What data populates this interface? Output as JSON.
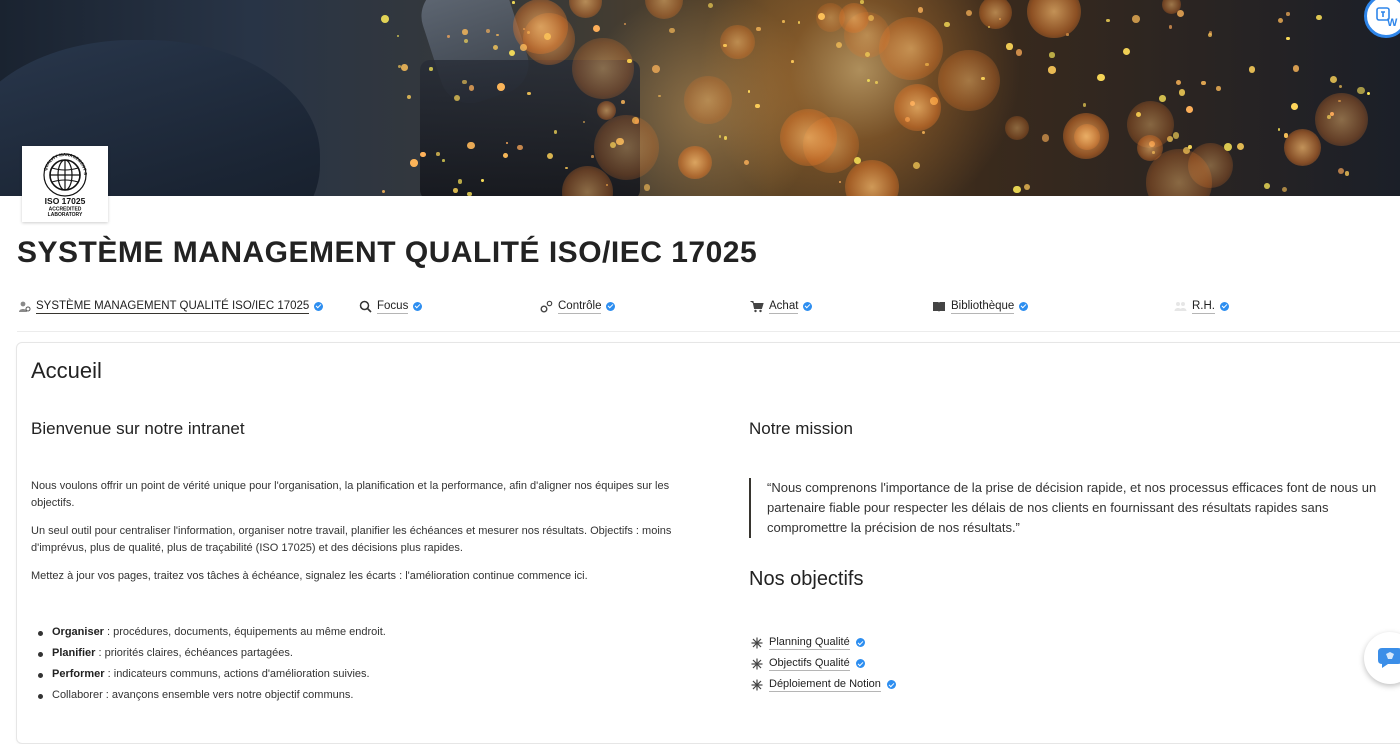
{
  "header": {
    "cover_image": "sparks-welding-cover",
    "logo": {
      "name": "iso-17025-logo",
      "ring_text": "QUALITY MANAGEMENT SYSTEM",
      "line1": "ISO 17025",
      "line2": "ACCREDITED",
      "line3": "LABORATORY"
    },
    "top_right_badge_icon": "translate-icon"
  },
  "page": {
    "title": "SYSTÈME MANAGEMENT QUALITÉ ISO/IEC 17025"
  },
  "nav": [
    {
      "label": "SYSTÈME MANAGEMENT QUALITÉ ISO/IEC 17025",
      "icon": "person-gear-icon"
    },
    {
      "label": "Focus",
      "icon": "magnifier-icon"
    },
    {
      "label": "Contrôle",
      "icon": "gears-icon"
    },
    {
      "label": "Achat",
      "icon": "cart-icon"
    },
    {
      "label": "Bibliothèque",
      "icon": "book-icon"
    },
    {
      "label": "R.H.",
      "icon": "people-icon"
    }
  ],
  "home": {
    "title": "Accueil",
    "welcome_heading": "Bienvenue sur notre intranet",
    "paragraphs": [
      "Nous voulons offrir un point de vérité unique pour l'organisation, la planification et la performance, afin d'aligner nos équipes sur les objectifs.",
      "Un seul outil pour centraliser l'information, organiser notre travail, planifier les échéances et mesurer nos résultats. Objectifs : moins d'imprévus, plus de qualité, plus de traçabilité (ISO 17025) et des décisions plus rapides.",
      "Mettez à jour vos pages, traitez vos tâches à échéance, signalez les écarts : l'amélioration continue commence ici."
    ],
    "bullets": [
      {
        "bold": "Organiser",
        "text": " : procédures, documents, équipements au même endroit."
      },
      {
        "bold": "Planifier",
        "text": " : priorités claires, échéances partagées."
      },
      {
        "bold": "Performer",
        "text": " : indicateurs communs, actions d'amélioration suivies."
      },
      {
        "bold": "",
        "text": "Collaborer : avançons ensemble vers notre objectif communs."
      }
    ],
    "mission_heading": "Notre mission",
    "mission_quote": "“Nous comprenons l'importance de la prise de décision rapide, et nos processus efficaces font de nous un partenaire fiable pour respecter les délais de nos clients en fournissant des résultats rapides sans compromettre la précision de nos résultats.”",
    "objectives_heading": "Nos objectifs",
    "objectives": [
      {
        "label": "Planning Qualité",
        "icon": "sparkle-icon"
      },
      {
        "label": "Objectifs Qualité",
        "icon": "sparkle-icon"
      },
      {
        "label": "Déploiement de Notion",
        "icon": "sparkle-icon"
      }
    ]
  },
  "floating": {
    "assistant_icon": "chat-assistant-icon"
  },
  "colors": {
    "verified": "#2d8ef0",
    "text": "#37352f",
    "badge_ring": "#2f86ea"
  }
}
